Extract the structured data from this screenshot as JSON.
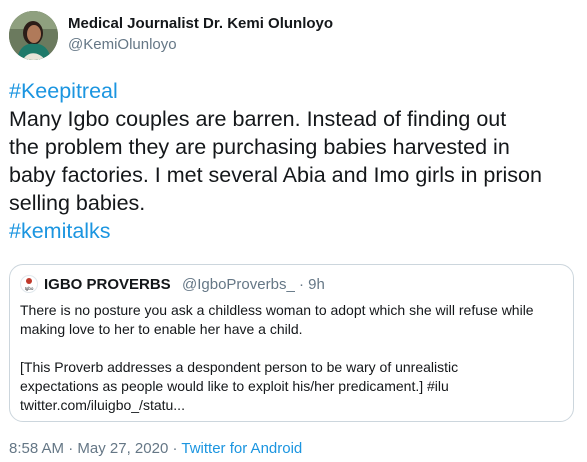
{
  "author": {
    "name": "Medical Journalist Dr. Kemi Olunloyo",
    "handle": "@KemiOlunloyo"
  },
  "tweet": {
    "hashtag_top": "#Keepitreal",
    "lines": [
      "Many Igbo couples are barren. Instead of finding out",
      "the problem they are purchasing babies harvested in",
      "baby factories. I met several Abia and Imo girls in prison",
      "selling babies."
    ],
    "hashtag_bottom": "#kemitalks"
  },
  "quoted_tweet": {
    "name": "IGBO PROVERBS",
    "handle": "@IgboProverbs_",
    "separator": "·",
    "time": "9h",
    "lines_1": [
      "There is no posture you ask a childless woman to adopt which she will refuse while",
      "making love to her to enable her have a child."
    ],
    "lines_2": [
      "[This Proverb addresses a despondent person to be wary of unrealistic",
      "expectations as people would like to exploit his/her predicament.] #ilu",
      "twitter.com/iluigbo_/statu..."
    ],
    "avatar_label": "Igbo"
  },
  "footer": {
    "time": "8:58 AM",
    "separator": "·",
    "date": "May 27, 2020",
    "source": "Twitter for Android"
  },
  "colors": {
    "link": "#1b95e0",
    "muted": "#657786",
    "text": "#14171a",
    "border": "#ccd6dd"
  }
}
